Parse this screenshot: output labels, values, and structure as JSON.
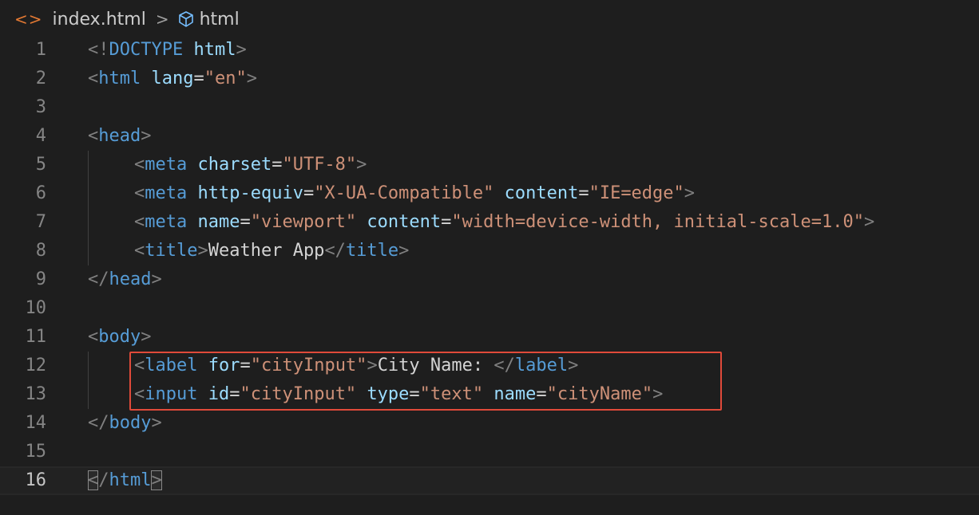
{
  "breadcrumb": {
    "file_icon": "<>",
    "file": "index.html",
    "separator": ">",
    "symbol": "html",
    "symbol_icon": "cube-icon"
  },
  "lines": [
    {
      "n": "1",
      "indent": 0,
      "tokens": [
        [
          "p",
          "<!"
        ],
        [
          "t",
          "DOCTYPE"
        ],
        [
          "tx",
          " "
        ],
        [
          "a",
          "html"
        ],
        [
          "p",
          ">"
        ]
      ]
    },
    {
      "n": "2",
      "indent": 0,
      "tokens": [
        [
          "p",
          "<"
        ],
        [
          "t",
          "html"
        ],
        [
          "tx",
          " "
        ],
        [
          "a",
          "lang"
        ],
        [
          "eq",
          "="
        ],
        [
          "s",
          "\"en\""
        ],
        [
          "p",
          ">"
        ]
      ]
    },
    {
      "n": "3",
      "indent": 0,
      "tokens": []
    },
    {
      "n": "4",
      "indent": 0,
      "tokens": [
        [
          "p",
          "<"
        ],
        [
          "t",
          "head"
        ],
        [
          "p",
          ">"
        ]
      ]
    },
    {
      "n": "5",
      "indent": 1,
      "tokens": [
        [
          "p",
          "<"
        ],
        [
          "t",
          "meta"
        ],
        [
          "tx",
          " "
        ],
        [
          "a",
          "charset"
        ],
        [
          "eq",
          "="
        ],
        [
          "s",
          "\"UTF-8\""
        ],
        [
          "p",
          ">"
        ]
      ]
    },
    {
      "n": "6",
      "indent": 1,
      "tokens": [
        [
          "p",
          "<"
        ],
        [
          "t",
          "meta"
        ],
        [
          "tx",
          " "
        ],
        [
          "a",
          "http-equiv"
        ],
        [
          "eq",
          "="
        ],
        [
          "s",
          "\"X-UA-Compatible\""
        ],
        [
          "tx",
          " "
        ],
        [
          "a",
          "content"
        ],
        [
          "eq",
          "="
        ],
        [
          "s",
          "\"IE=edge\""
        ],
        [
          "p",
          ">"
        ]
      ]
    },
    {
      "n": "7",
      "indent": 1,
      "tokens": [
        [
          "p",
          "<"
        ],
        [
          "t",
          "meta"
        ],
        [
          "tx",
          " "
        ],
        [
          "a",
          "name"
        ],
        [
          "eq",
          "="
        ],
        [
          "s",
          "\"viewport\""
        ],
        [
          "tx",
          " "
        ],
        [
          "a",
          "content"
        ],
        [
          "eq",
          "="
        ],
        [
          "s",
          "\"width=device-width, initial-scale=1.0\""
        ],
        [
          "p",
          ">"
        ]
      ]
    },
    {
      "n": "8",
      "indent": 1,
      "tokens": [
        [
          "p",
          "<"
        ],
        [
          "t",
          "title"
        ],
        [
          "p",
          ">"
        ],
        [
          "tx",
          "Weather App"
        ],
        [
          "p",
          "</"
        ],
        [
          "t",
          "title"
        ],
        [
          "p",
          ">"
        ]
      ]
    },
    {
      "n": "9",
      "indent": 0,
      "tokens": [
        [
          "p",
          "</"
        ],
        [
          "t",
          "head"
        ],
        [
          "p",
          ">"
        ]
      ]
    },
    {
      "n": "10",
      "indent": 0,
      "tokens": []
    },
    {
      "n": "11",
      "indent": 0,
      "tokens": [
        [
          "p",
          "<"
        ],
        [
          "t",
          "body"
        ],
        [
          "p",
          ">"
        ]
      ]
    },
    {
      "n": "12",
      "indent": 1,
      "tokens": [
        [
          "p",
          "<"
        ],
        [
          "t",
          "label"
        ],
        [
          "tx",
          " "
        ],
        [
          "a",
          "for"
        ],
        [
          "eq",
          "="
        ],
        [
          "s",
          "\"cityInput\""
        ],
        [
          "p",
          ">"
        ],
        [
          "tx",
          "City Name: "
        ],
        [
          "p",
          "</"
        ],
        [
          "t",
          "label"
        ],
        [
          "p",
          ">"
        ]
      ]
    },
    {
      "n": "13",
      "indent": 1,
      "tokens": [
        [
          "p",
          "<"
        ],
        [
          "t",
          "input"
        ],
        [
          "tx",
          " "
        ],
        [
          "a",
          "id"
        ],
        [
          "eq",
          "="
        ],
        [
          "s",
          "\"cityInput\""
        ],
        [
          "tx",
          " "
        ],
        [
          "a",
          "type"
        ],
        [
          "eq",
          "="
        ],
        [
          "s",
          "\"text\""
        ],
        [
          "tx",
          " "
        ],
        [
          "a",
          "name"
        ],
        [
          "eq",
          "="
        ],
        [
          "s",
          "\"cityName\""
        ],
        [
          "p",
          ">"
        ]
      ]
    },
    {
      "n": "14",
      "indent": 0,
      "tokens": [
        [
          "p",
          "</"
        ],
        [
          "t",
          "body"
        ],
        [
          "p",
          ">"
        ]
      ]
    },
    {
      "n": "15",
      "indent": 0,
      "tokens": []
    },
    {
      "n": "16",
      "indent": 0,
      "current": true,
      "tokens": [
        [
          "pm",
          "<"
        ],
        [
          "p",
          "/"
        ],
        [
          "t",
          "html"
        ],
        [
          "pm",
          ">"
        ]
      ]
    }
  ],
  "colors": {
    "background": "#1e1e1e",
    "tag": "#569cd6",
    "attribute": "#9cdcfe",
    "string": "#ce9178",
    "punctuation": "#808080",
    "text": "#d4d4d4",
    "highlight_box": "#e04a3a"
  }
}
